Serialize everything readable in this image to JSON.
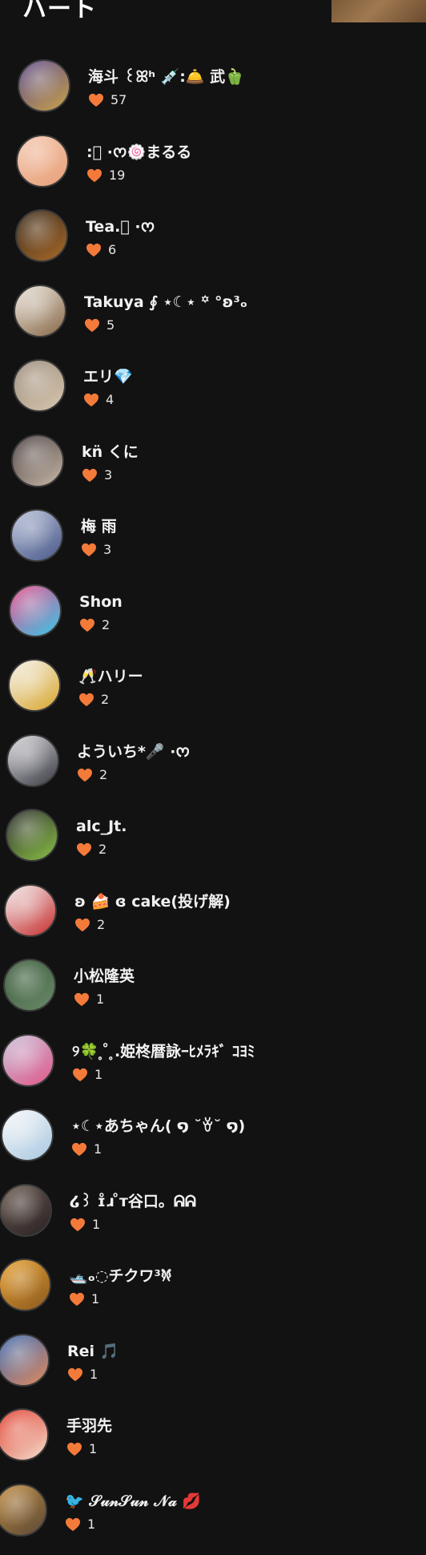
{
  "page": {
    "title": "ハート"
  },
  "colors": {
    "heart": "#F47A3A",
    "background": "#121212"
  },
  "users": [
    {
      "name": "海斗 ꒰ꕤʰ 💉:🛎️ 武🫑",
      "count": "57",
      "avatar_colors": [
        "#5b4a8a",
        "#c9a24a"
      ]
    },
    {
      "name": ":⃝ ·ᰔ🍥まるる",
      "count": "19",
      "avatar_colors": [
        "#f4c9b0",
        "#e8a07a"
      ]
    },
    {
      "name": "Tea.⃝ ·ᰔ",
      "count": "6",
      "avatar_colors": [
        "#3a2a1a",
        "#a86a2a"
      ]
    },
    {
      "name": "Takuya ∮ ⋆☾⋆ ꙳ °ʚ³ₒ",
      "count": "5",
      "avatar_colors": [
        "#e8e2d8",
        "#8a6a4a"
      ]
    },
    {
      "name": "エリ💎",
      "count": "4",
      "avatar_colors": [
        "#9a8a7a",
        "#d8c8b0"
      ]
    },
    {
      "name": "kn̈ くに",
      "count": "3",
      "avatar_colors": [
        "#4a4040",
        "#c8b8a8"
      ]
    },
    {
      "name": "梅 雨",
      "count": "3",
      "avatar_colors": [
        "#b8c0d8",
        "#4a5a8a"
      ]
    },
    {
      "name": "Shon",
      "count": "2",
      "avatar_colors": [
        "#e84a8a",
        "#3ac8e8"
      ]
    },
    {
      "name": "🥂ハリー",
      "count": "2",
      "avatar_colors": [
        "#f4f0e8",
        "#d8a830"
      ]
    },
    {
      "name": "よういち*🎤 ·ᰔ",
      "count": "2",
      "avatar_colors": [
        "#d8d8dc",
        "#3a3a44"
      ]
    },
    {
      "name": "alc_Jt.",
      "count": "2",
      "avatar_colors": [
        "#2a2a2a",
        "#8ac048"
      ]
    },
    {
      "name": "ʚ 🍰 ɞ cake(投げ解)",
      "count": "2",
      "avatar_colors": [
        "#f0e8e8",
        "#c83030"
      ]
    },
    {
      "name": "小松隆英",
      "count": "1",
      "avatar_colors": [
        "#3a5a3a",
        "#6a8a6a"
      ]
    },
    {
      "name": "୨🍀 ̥  ̊ ̥.姫柊暦詠ｰﾋﾒﾗｷﾞ ｺﾖﾐ",
      "count": "1",
      "avatar_colors": [
        "#c8c0d8",
        "#e05a8a"
      ]
    },
    {
      "name": "⋆☾⋆あちゃん( ໑ ˘ꈊ˘ ໑)",
      "count": "1",
      "avatar_colors": [
        "#f8f8fa",
        "#a8c8e0"
      ]
    },
    {
      "name": "໒꒱ ɪ̊ɹ ̊ᴛ谷口。ᕱᕱ",
      "count": "1",
      "avatar_colors": [
        "#6a5a50",
        "#2a2224"
      ]
    },
    {
      "name": "🛥️ₒ◌チクワ𐦍³",
      "count": "1",
      "avatar_colors": [
        "#e8a030",
        "#8a5a20"
      ]
    },
    {
      "name": "Rei 🎵",
      "count": "1",
      "avatar_colors": [
        "#3a6ab0",
        "#e08a60"
      ]
    },
    {
      "name": "手羽先",
      "count": "1",
      "avatar_colors": [
        "#e03a2a",
        "#f4e0d0"
      ]
    },
    {
      "name": "🐦 𝒮𝓊𝓃𝒮𝓊𝓃 𝒩𝒶 💋",
      "count": "1",
      "avatar_colors": [
        "#c08a40",
        "#5a4a38"
      ]
    }
  ]
}
